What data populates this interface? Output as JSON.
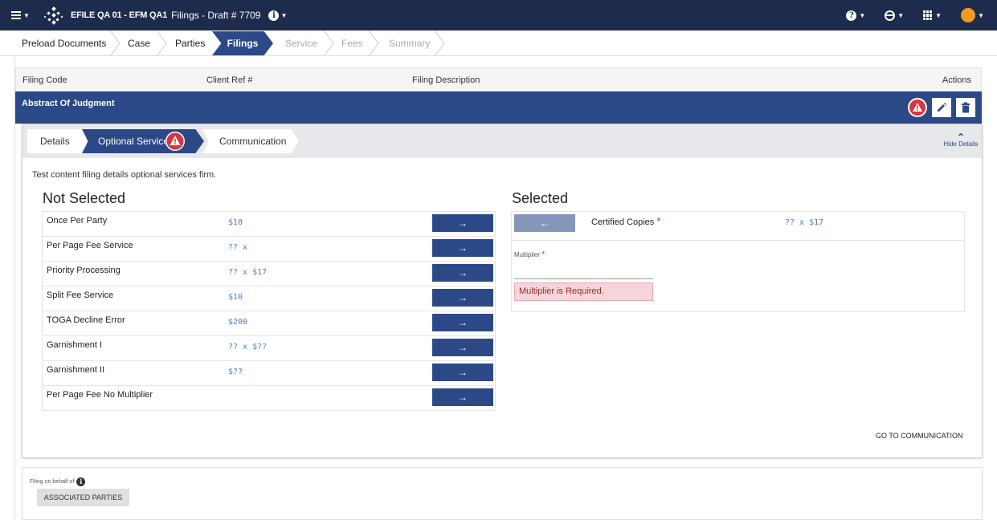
{
  "header": {
    "app_title": "EFILE QA 01 - EFM QA1",
    "draft_label": "Filings - Draft # 7709",
    "info_glyph": "i",
    "help_glyph": "?",
    "icons": [
      "menu-icon",
      "logo-icon",
      "info-icon",
      "help-icon",
      "globe-icon",
      "apps-grid-icon",
      "user-avatar"
    ]
  },
  "wizard": {
    "steps": [
      {
        "label": "Preload Documents",
        "state": "done"
      },
      {
        "label": "Case",
        "state": "done"
      },
      {
        "label": "Parties",
        "state": "done"
      },
      {
        "label": "Filings",
        "state": "active"
      },
      {
        "label": "Service",
        "state": "disabled"
      },
      {
        "label": "Fees",
        "state": "disabled"
      },
      {
        "label": "Summary",
        "state": "disabled"
      }
    ]
  },
  "table": {
    "headers": {
      "filing_code": "Filing Code",
      "client_ref": "Client Ref #",
      "description": "Filing Description",
      "actions": "Actions"
    },
    "filing_name": "Abstract Of Judgment"
  },
  "details": {
    "tabs": [
      {
        "label": "Details",
        "active": false
      },
      {
        "label": "Optional Services",
        "active": true,
        "warning": true
      },
      {
        "label": "Communication",
        "active": false
      }
    ],
    "hide_details": "Hide Details",
    "intro": "Test content filing details optional services firm.",
    "not_selected_heading": "Not Selected",
    "selected_heading": "Selected",
    "add_arrow": "→",
    "remove_arrow": "←",
    "not_selected": [
      {
        "name": "Once Per Party",
        "price": "$10"
      },
      {
        "name": "Per Page Fee Service",
        "price": "?? x"
      },
      {
        "name": "Priority Processing",
        "price": "?? x $17"
      },
      {
        "name": "Split Fee Service",
        "price": "$10"
      },
      {
        "name": "TOGA Decline Error",
        "price": "$200"
      },
      {
        "name": "Garnishment I",
        "price": "?? x $??"
      },
      {
        "name": "Garnishment II",
        "price": "$??"
      },
      {
        "name": "Per Page Fee No Multiplier",
        "price": ""
      }
    ],
    "selected": {
      "name": "Certified Copies",
      "required_mark": "*",
      "price": "?? x $17",
      "multiplier_label": "Multiplier",
      "multiplier_value": "",
      "error": "Multiplier is Required."
    },
    "goto_label": "GO TO COMMUNICATION"
  },
  "bottom": {
    "filing_on_behalf": "Filing on behalf of",
    "info_glyph": "i",
    "associated_parties": "ASSOCIATED PARTIES"
  },
  "colors": {
    "nav": "#1d2b4d",
    "accent": "#2c4987",
    "error_bg": "#f5d5d8",
    "warning": "#d9343f",
    "avatar": "#f29a1f"
  }
}
